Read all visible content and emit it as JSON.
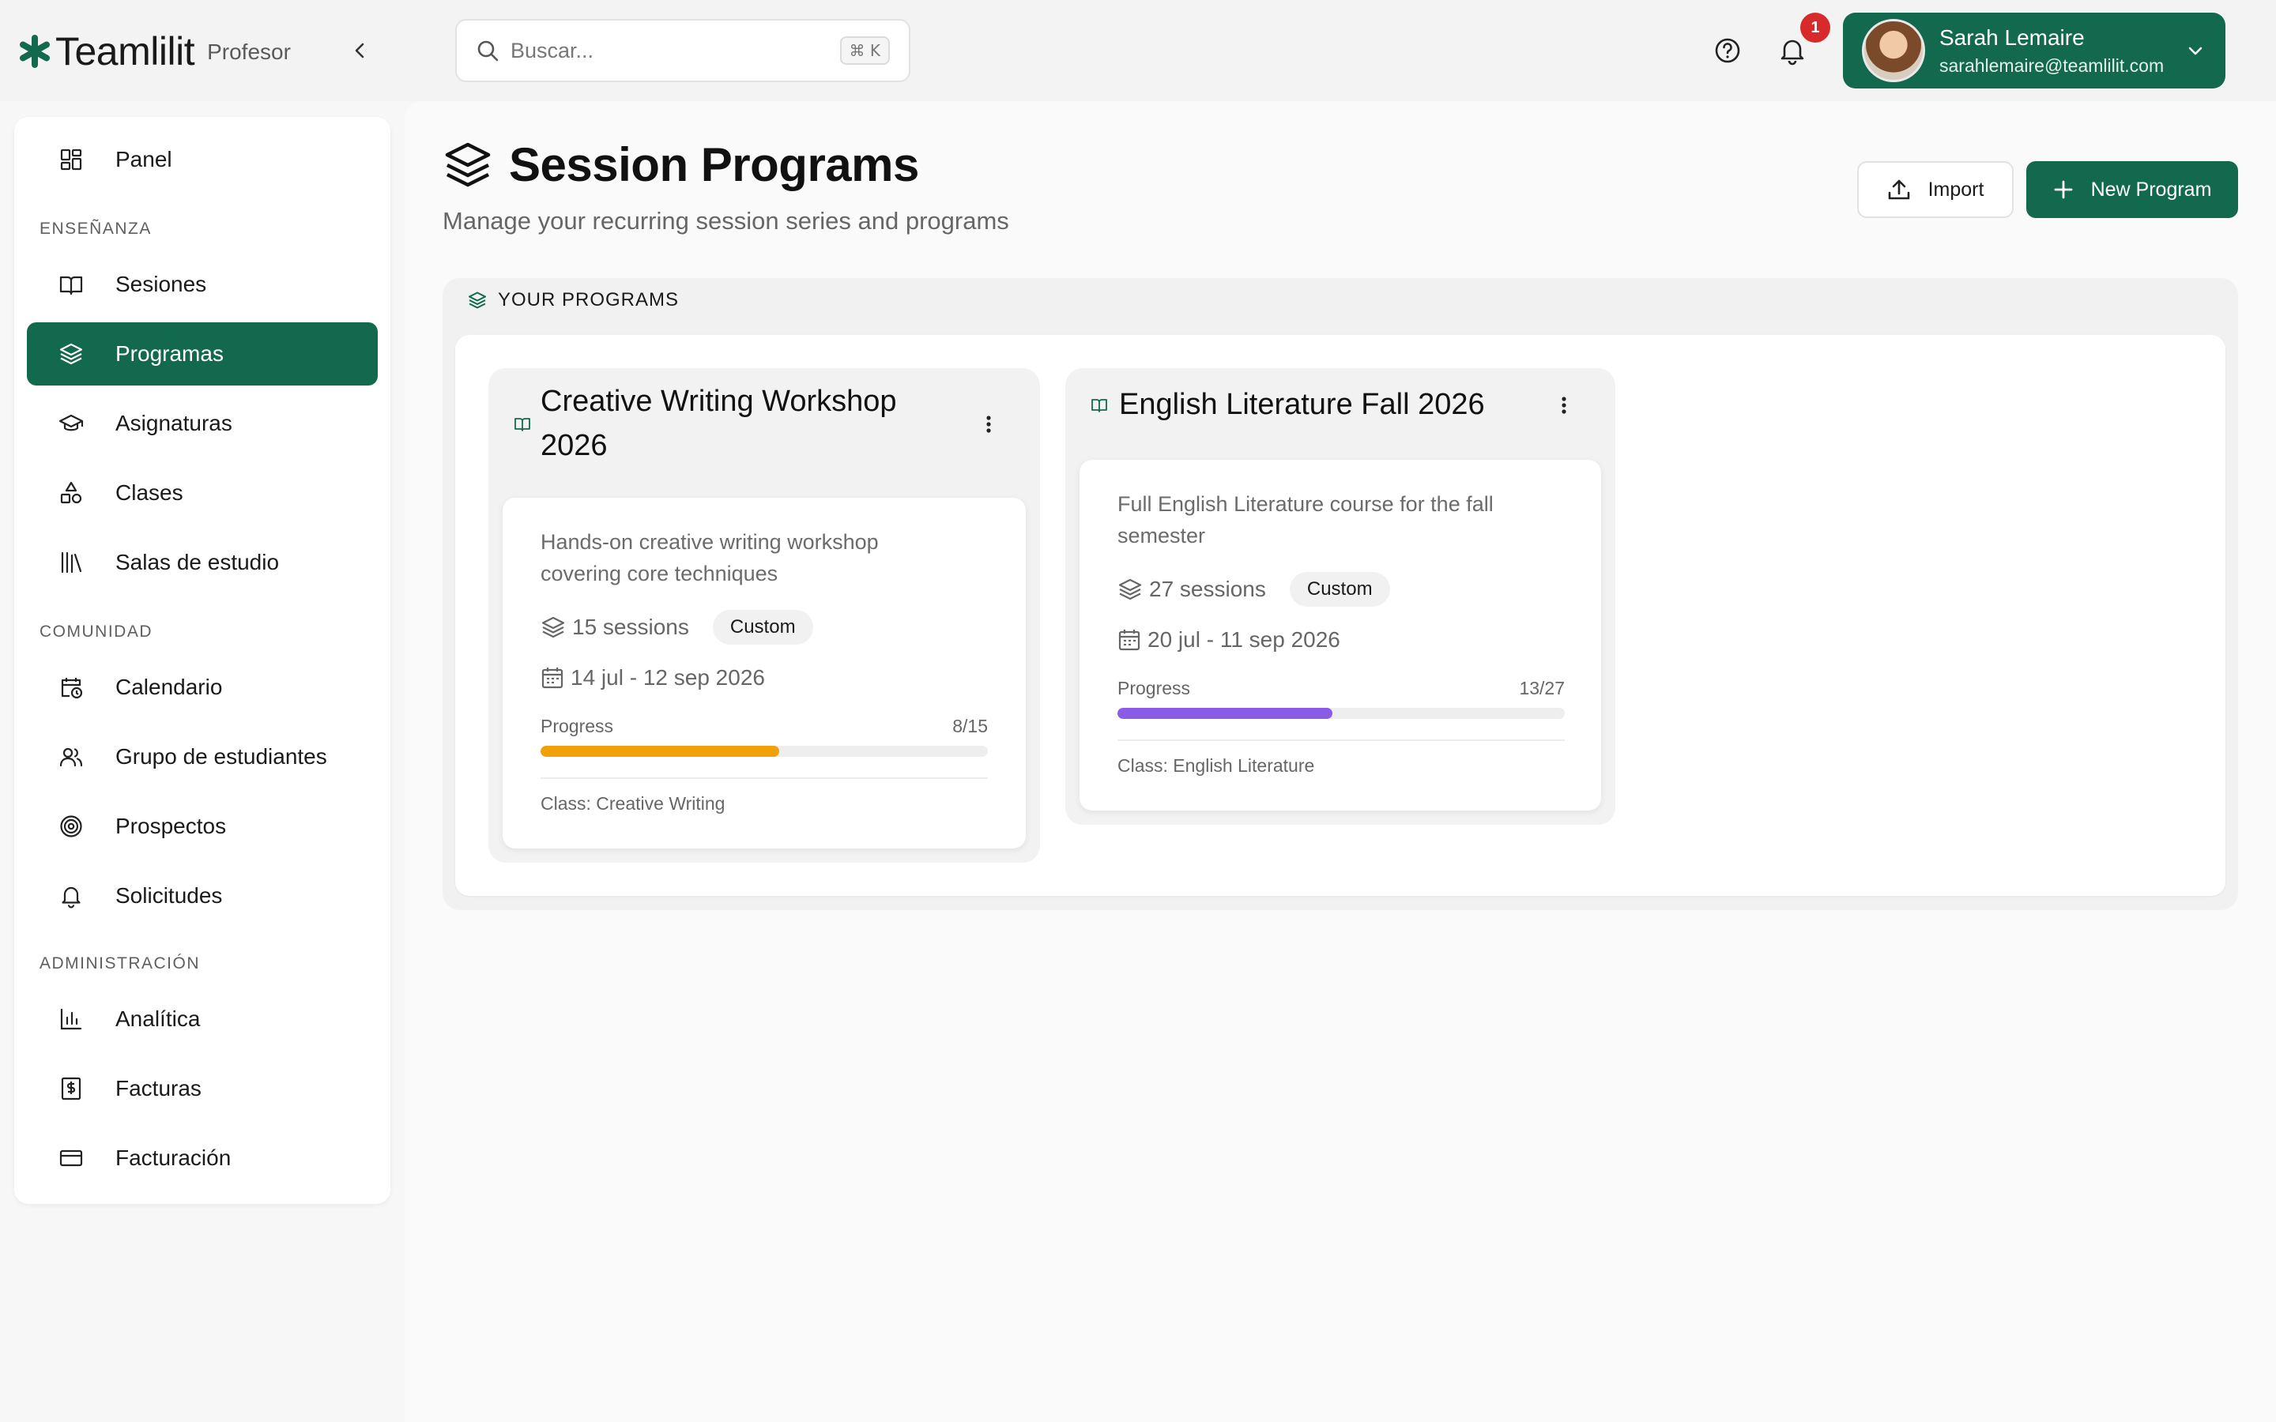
{
  "brand": {
    "name": "Teamlilit",
    "role": "Profesor"
  },
  "search": {
    "placeholder": "Buscar...",
    "shortcut": "⌘ K"
  },
  "notifications": {
    "count": "1"
  },
  "user": {
    "name": "Sarah Lemaire",
    "email": "sarahlemaire@teamlilit.com"
  },
  "sidebar": {
    "top_item": {
      "label": "Panel",
      "icon": "grid-icon"
    },
    "sections": [
      {
        "title": "ENSEÑANZA",
        "items": [
          {
            "label": "Sesiones",
            "icon": "book-icon"
          },
          {
            "label": "Programas",
            "icon": "layers-icon",
            "active": true
          },
          {
            "label": "Asignaturas",
            "icon": "graduation-cap-icon"
          },
          {
            "label": "Clases",
            "icon": "shapes-icon"
          },
          {
            "label": "Salas de estudio",
            "icon": "library-icon"
          }
        ]
      },
      {
        "title": "COMUNIDAD",
        "items": [
          {
            "label": "Calendario",
            "icon": "calendar-clock-icon"
          },
          {
            "label": "Grupo de estudiantes",
            "icon": "users-icon"
          },
          {
            "label": "Prospectos",
            "icon": "target-icon"
          },
          {
            "label": "Solicitudes",
            "icon": "bell-icon"
          }
        ]
      },
      {
        "title": "ADMINISTRACIÓN",
        "items": [
          {
            "label": "Analítica",
            "icon": "bar-chart-icon"
          },
          {
            "label": "Facturas",
            "icon": "receipt-icon"
          },
          {
            "label": "Facturación",
            "icon": "credit-card-icon"
          }
        ]
      }
    ]
  },
  "page": {
    "title": "Session Programs",
    "subtitle": "Manage your recurring session series and programs",
    "import_label": "Import",
    "new_label": "New Program",
    "section_label": "YOUR PROGRAMS"
  },
  "programs": [
    {
      "title_line1": "Creative Writing Workshop",
      "title_line2": "2026",
      "desc_line1": "Hands-on creative writing workshop",
      "desc_line2": "covering core techniques",
      "sessions": "15 sessions",
      "badge": "Custom",
      "dates": "14 jul - 12 sep 2026",
      "progress_label": "Progress",
      "progress_text": "8/15",
      "progress_fraction": 0.533,
      "progress_color": "#f0a10a",
      "class": "Class: Creative Writing"
    },
    {
      "title_line1": "English Literature Fall 2026",
      "desc_line1": "Full English Literature course for the fall",
      "desc_line2": "semester",
      "sessions": "27 sessions",
      "badge": "Custom",
      "dates": "20 jul - 11 sep 2026",
      "progress_label": "Progress",
      "progress_text": "13/27",
      "progress_fraction": 0.481,
      "progress_color": "#8a5ce6",
      "class": "Class: English Literature"
    }
  ],
  "colors": {
    "brand": "#13694d",
    "badge": "#d72b2b"
  }
}
